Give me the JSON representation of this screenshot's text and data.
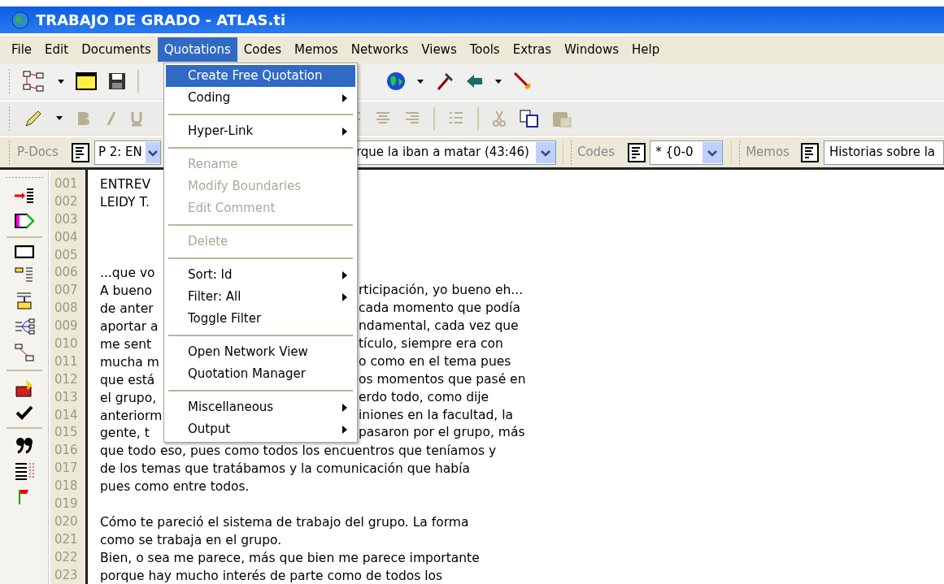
{
  "window": {
    "title": "TRABAJO DE GRADO - ATLAS.ti"
  },
  "menu_bar": [
    {
      "label": "File",
      "selected": false
    },
    {
      "label": "Edit",
      "selected": false
    },
    {
      "label": "Documents",
      "selected": false
    },
    {
      "label": "Quotations",
      "selected": true
    },
    {
      "label": "Codes",
      "selected": false
    },
    {
      "label": "Memos",
      "selected": false
    },
    {
      "label": "Networks",
      "selected": false
    },
    {
      "label": "Views",
      "selected": false
    },
    {
      "label": "Tools",
      "selected": false
    },
    {
      "label": "Extras",
      "selected": false
    },
    {
      "label": "Windows",
      "selected": false
    },
    {
      "label": "Help",
      "selected": false
    }
  ],
  "quotations_menu": [
    {
      "kind": "item",
      "label": "Create Free Quotation",
      "selected": true,
      "disabled": false,
      "submenu": false
    },
    {
      "kind": "item",
      "label": "Coding",
      "selected": false,
      "disabled": false,
      "submenu": true
    },
    {
      "kind": "separator"
    },
    {
      "kind": "item",
      "label": "Hyper-Link",
      "selected": false,
      "disabled": false,
      "submenu": true
    },
    {
      "kind": "separator"
    },
    {
      "kind": "item",
      "label": "Rename",
      "selected": false,
      "disabled": true,
      "submenu": false
    },
    {
      "kind": "item",
      "label": "Modify Boundaries",
      "selected": false,
      "disabled": true,
      "submenu": false
    },
    {
      "kind": "item",
      "label": "Edit Comment",
      "selected": false,
      "disabled": true,
      "submenu": false
    },
    {
      "kind": "separator"
    },
    {
      "kind": "item",
      "label": "Delete",
      "selected": false,
      "disabled": true,
      "submenu": false
    },
    {
      "kind": "separator"
    },
    {
      "kind": "item",
      "label": "Sort: Id",
      "selected": false,
      "disabled": false,
      "submenu": true
    },
    {
      "kind": "item",
      "label": "Filter: All",
      "selected": false,
      "disabled": false,
      "submenu": true
    },
    {
      "kind": "item",
      "label": "Toggle Filter",
      "selected": false,
      "disabled": false,
      "submenu": false
    },
    {
      "kind": "separator"
    },
    {
      "kind": "item",
      "label": "Open Network View",
      "selected": false,
      "disabled": false,
      "submenu": false
    },
    {
      "kind": "item",
      "label": "Quotation Manager",
      "selected": false,
      "disabled": false,
      "submenu": false
    },
    {
      "kind": "separator"
    },
    {
      "kind": "item",
      "label": "Miscellaneous",
      "selected": false,
      "disabled": false,
      "submenu": true
    },
    {
      "kind": "item",
      "label": "Output",
      "selected": false,
      "disabled": false,
      "submenu": true
    }
  ],
  "selector_bar": {
    "p_docs_label": "P-Docs",
    "p_docs_value": "P 2: EN",
    "quotation_value": "rque la iban a matar (43:46)",
    "codes_label": "Codes",
    "codes_value": "* {0-0",
    "memos_label": "Memos",
    "memos_value": "Historias sobre la"
  },
  "document": {
    "lines": [
      {
        "number": "001",
        "left": "ENTREV"
      },
      {
        "number": "002",
        "left": "LEIDY T."
      },
      {
        "number": "003"
      },
      {
        "number": "004"
      },
      {
        "number": "005"
      },
      {
        "number": "006",
        "left": "...que vo"
      },
      {
        "number": "007",
        "left": "A bueno",
        "right": "rticipación, yo bueno eh..."
      },
      {
        "number": "008",
        "left": "de anter",
        "right": "cada momento que podía"
      },
      {
        "number": "009",
        "left": "aportar a",
        "right": "ndamental, cada vez que"
      },
      {
        "number": "010",
        "left": "me sent",
        "right": "tículo, siempre era con"
      },
      {
        "number": "011",
        "left": "mucha m",
        "right": "o como en el tema pues"
      },
      {
        "number": "012",
        "left": "que está",
        "right": "os momentos que pasé en"
      },
      {
        "number": "013",
        "left": "el grupo,",
        "right": "erdo todo, como dije"
      },
      {
        "number": "014",
        "left": "anteriorm",
        "right": "iniones en la facultad, la"
      },
      {
        "number": "015",
        "left": "gente, t",
        "right": "pasaron por el grupo, más"
      },
      {
        "number": "016",
        "left": "que todo eso, pues como todos los encuentros que teníamos y"
      },
      {
        "number": "017",
        "left": "de los temas que tratábamos y la comunicación que había"
      },
      {
        "number": "018",
        "left": "pues como entre todos."
      },
      {
        "number": "019"
      },
      {
        "number": "020",
        "left": "Cómo te pareció el sistema de trabajo del grupo.  La forma"
      },
      {
        "number": "021",
        "left": "como se trabaja en el grupo."
      },
      {
        "number": "022",
        "left": "Bien, o sea me parece, más que bien me parece importante"
      },
      {
        "number": "023",
        "left": "porque hay mucho interés de parte como de todos los"
      }
    ]
  }
}
